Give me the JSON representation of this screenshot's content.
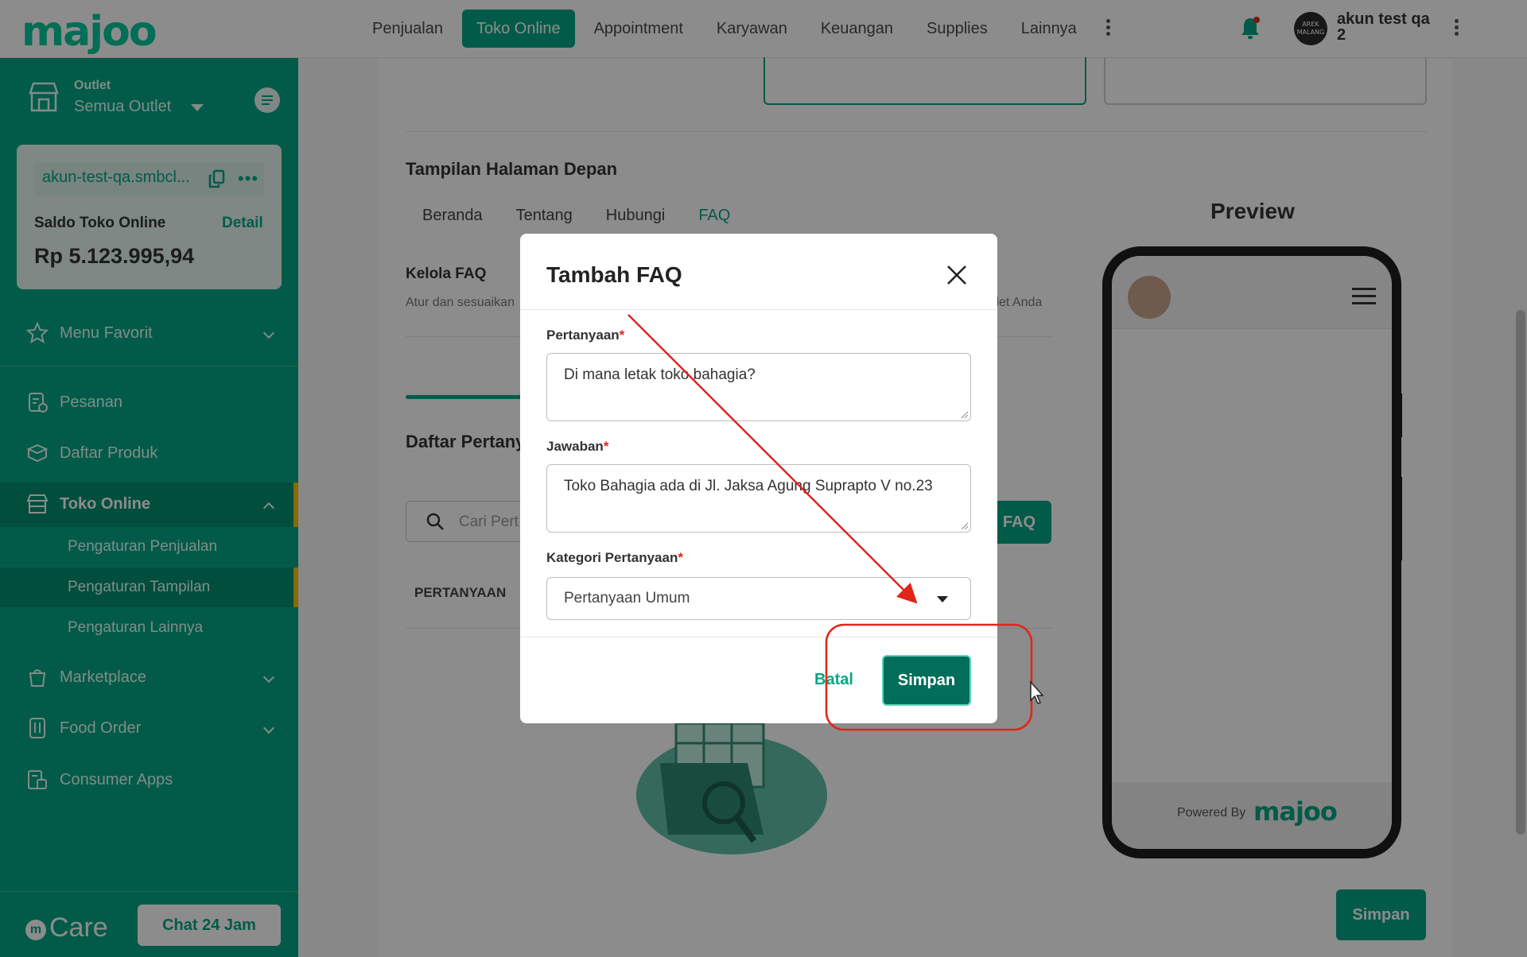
{
  "topbar": {
    "logo": "majoo",
    "nav": [
      "Penjualan",
      "Toko Online",
      "Appointment",
      "Karyawan",
      "Keuangan",
      "Supplies",
      "Lainnya"
    ],
    "active_nav": "Toko Online",
    "avatar_text": "AREK MALANG",
    "user_name": "akun test qa 2"
  },
  "sidebar": {
    "outlet_label": "Outlet",
    "outlet_value": "Semua Outlet",
    "store_name": "akun-test-qa.smbcl...",
    "saldo_label": "Saldo Toko Online",
    "saldo_detail": "Detail",
    "saldo_value": "Rp 5.123.995,94",
    "items": [
      {
        "label": "Menu Favorit",
        "icon": "star-icon"
      },
      {
        "label": "Pesanan",
        "icon": "order-icon"
      },
      {
        "label": "Daftar Produk",
        "icon": "box-icon"
      },
      {
        "label": "Toko Online",
        "icon": "store-icon"
      },
      {
        "label": "Marketplace",
        "icon": "marketplace-icon"
      },
      {
        "label": "Food Order",
        "icon": "food-order-icon"
      },
      {
        "label": "Consumer Apps",
        "icon": "consumer-apps-icon"
      }
    ],
    "sub_items": [
      "Pengaturan Penjualan",
      "Pengaturan Tampilan",
      "Pengaturan Lainnya"
    ],
    "active_sub": "Pengaturan Tampilan",
    "care_label": "Care",
    "chat_button": "Chat 24 Jam"
  },
  "main": {
    "section_title": "Tampilan Halaman Depan",
    "tabs": [
      "Beranda",
      "Tentang",
      "Hubungi",
      "FAQ"
    ],
    "active_tab": "FAQ",
    "kelola_title": "Kelola FAQ",
    "kelola_desc_start": "Atur dan sesuaikan",
    "kelola_desc_end": "tlet Anda",
    "daftar_title": "Daftar Pertany",
    "search_placeholder": "Cari Pert",
    "add_faq_partial": "h FAQ",
    "column_header": "PERTANYAAN",
    "preview_title": "Preview",
    "powered_by": "Powered By",
    "powered_logo": "majoo",
    "save_button": "Simpan"
  },
  "modal": {
    "title": "Tambah FAQ",
    "question_label": "Pertanyaan",
    "question_value": "Di mana letak toko bahagia?",
    "answer_label": "Jawaban",
    "answer_value": "Toko Bahagia ada di Jl. Jaksa Agung Suprapto V no.23",
    "category_label": "Kategori Pertanyaan",
    "category_value": "Pertanyaan Umum",
    "required_mark": "*",
    "cancel_button": "Batal",
    "save_button": "Simpan"
  },
  "colors": {
    "brand": "#04a783",
    "brand_dark": "#006e5a",
    "accent": "#f2c400",
    "annotation": "#e0251b"
  }
}
